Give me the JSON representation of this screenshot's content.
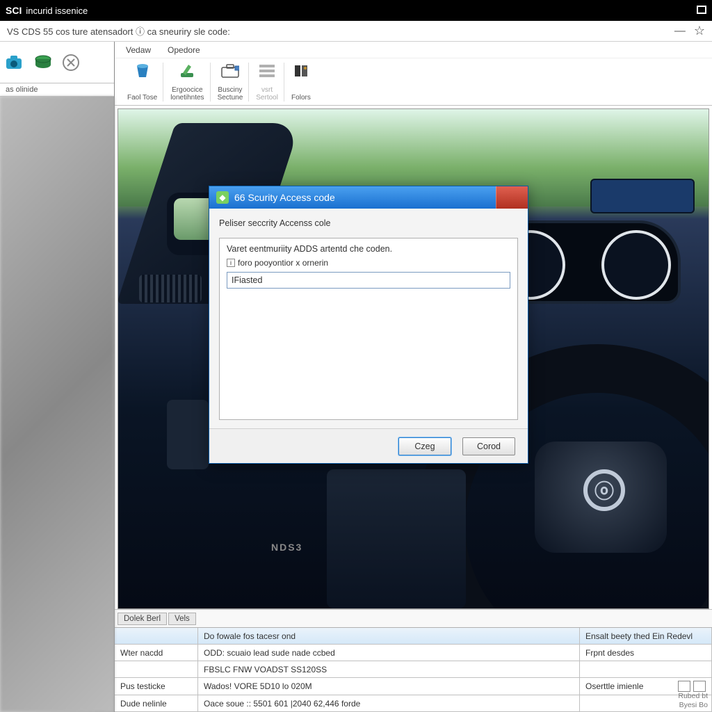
{
  "titlebar": {
    "brand": "SCI",
    "subtitle": "incurid issenice"
  },
  "menubar": {
    "title": "VS CDS 55 cos ture atensadort  ⓘ ca sneuriry sle code:",
    "minimize": "—"
  },
  "sidebar": {
    "label": "as olinide"
  },
  "menu_strip": {
    "items": [
      "Vedaw",
      "Opedore"
    ]
  },
  "ribbon": {
    "items": [
      {
        "label_top": "Faol Tose",
        "label_bot": ""
      },
      {
        "label_top": "Ergoocice",
        "label_bot": "lonetihntes"
      },
      {
        "label_top": "Busciny",
        "label_bot": "Sectune"
      },
      {
        "label_top": "vsrt",
        "label_bot": "Sertool",
        "muted": true
      },
      {
        "label_top": "Folors",
        "label_bot": ""
      }
    ]
  },
  "dialog": {
    "title": "66 Scurity Access code",
    "subtitle": "Peliser seccrity Accenss cole",
    "instruction": "Varet eentmuriity ADDS artentd che coden.",
    "field_label": "foro pooyontior x ornerin",
    "input_value": "IFiasted",
    "ok_label": "Czeg",
    "cancel_label": "Corod"
  },
  "viewport": {
    "brand_text": "NDS3"
  },
  "bottom_tabs": {
    "tabs": [
      "Dolek Berl",
      "Vels"
    ]
  },
  "info": {
    "col0_row0": "",
    "col1_row0": "Do fowale fos tacesr ond",
    "col2_row0": "Ensalt beety thed Ein Redevl",
    "col0_row1": "Wter nacdd",
    "col1_row1": "ODD: scuaio lead sude nade ccbed",
    "col2_row1": "Frpnt desdes",
    "col0_row2": "",
    "col1_row2": "FBSLC FNW VOADST SS120SS",
    "col2_row2": "",
    "col0_row3": "Pus testicke",
    "col1_row3": "Wados! VORE 5D10 lo 020M",
    "col2_row3": "Oserttle imienle",
    "col0_row4": "Dude nelinle",
    "col1_row4": "Oace soue ::  5501 601 |2040 62,446 forde",
    "col2_row4": ""
  },
  "footer": {
    "line1": "Rubed bt",
    "line2": "Byesi Bo"
  }
}
